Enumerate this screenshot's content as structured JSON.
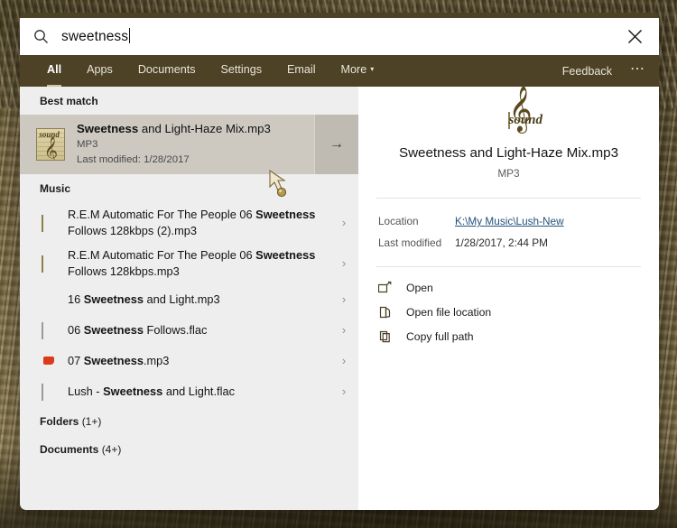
{
  "search": {
    "query": "sweetness",
    "search_icon": "search-icon",
    "close_icon": "close-icon",
    "close_label": "Close"
  },
  "filters": {
    "items": [
      {
        "label": "All",
        "active": true
      },
      {
        "label": "Apps",
        "active": false
      },
      {
        "label": "Documents",
        "active": false
      },
      {
        "label": "Settings",
        "active": false
      },
      {
        "label": "Email",
        "active": false
      },
      {
        "label": "More",
        "active": false,
        "caret": "▾"
      }
    ],
    "feedback_label": "Feedback",
    "more_options_icon": "ellipsis-icon"
  },
  "results": {
    "best_match_header": "Best match",
    "best_match": {
      "title_bold": "Sweetness",
      "title_rest": " and Light-Haze Mix.mp3",
      "type": "MP3",
      "modified": "Last modified: 1/28/2017",
      "icon": "music-sheet-icon",
      "arrow_icon": "arrow-right-icon"
    },
    "music_header": "Music",
    "music_items": [
      {
        "pre": "R.E.M Automatic For The People 06 ",
        "bold": "Sweetness",
        "post": " Follows 128kbps (2).mp3",
        "icon": "music-sheet-icon",
        "chevron": "chevron-right-icon"
      },
      {
        "pre": "R.E.M Automatic For The People 06 ",
        "bold": "Sweetness",
        "post": " Follows 128kbps.mp3",
        "icon": "music-sheet-icon",
        "chevron": "chevron-right-icon"
      },
      {
        "pre": "16 ",
        "bold": "Sweetness",
        "post": " and Light.mp3",
        "icon": "album-art-icon",
        "chevron": "chevron-right-icon"
      },
      {
        "pre": "06 ",
        "bold": "Sweetness",
        "post": " Follows.flac",
        "icon": "flac-file-icon",
        "chevron": "chevron-right-icon"
      },
      {
        "pre": "07 ",
        "bold": "Sweetness",
        "post": ".mp3",
        "icon": "media-player-icon",
        "chevron": "chevron-right-icon"
      },
      {
        "pre": "Lush - ",
        "bold": "Sweetness",
        "post": " and Light.flac",
        "icon": "flac-file-icon",
        "chevron": "chevron-right-icon"
      }
    ],
    "folders_header": "Folders",
    "folders_count": "(1+)",
    "documents_header": "Documents",
    "documents_count": "(4+)"
  },
  "preview": {
    "icon": "music-sheet-icon",
    "icon_word": "sound",
    "name": "Sweetness and Light-Haze Mix.mp3",
    "type": "MP3",
    "meta": [
      {
        "key": "Location",
        "value": "K:\\My Music\\Lush-New",
        "is_link": true
      },
      {
        "key": "Last modified",
        "value": "1/28/2017, 2:44 PM",
        "is_link": false
      }
    ],
    "actions": [
      {
        "label": "Open",
        "icon": "open-external-icon"
      },
      {
        "label": "Open file location",
        "icon": "folder-open-icon"
      },
      {
        "label": "Copy full path",
        "icon": "copy-icon"
      }
    ]
  },
  "colors": {
    "header_bg": "#4d4226",
    "results_bg": "#eeeeee",
    "preview_bg": "#ffffff",
    "best_match_bg": "#cdc9c1",
    "best_match_arrow_bg": "#bfbab2",
    "link": "#23527c",
    "accent_underline": "#cfc4a0"
  },
  "cursor": {
    "name": "custom-pointer-cursor"
  }
}
